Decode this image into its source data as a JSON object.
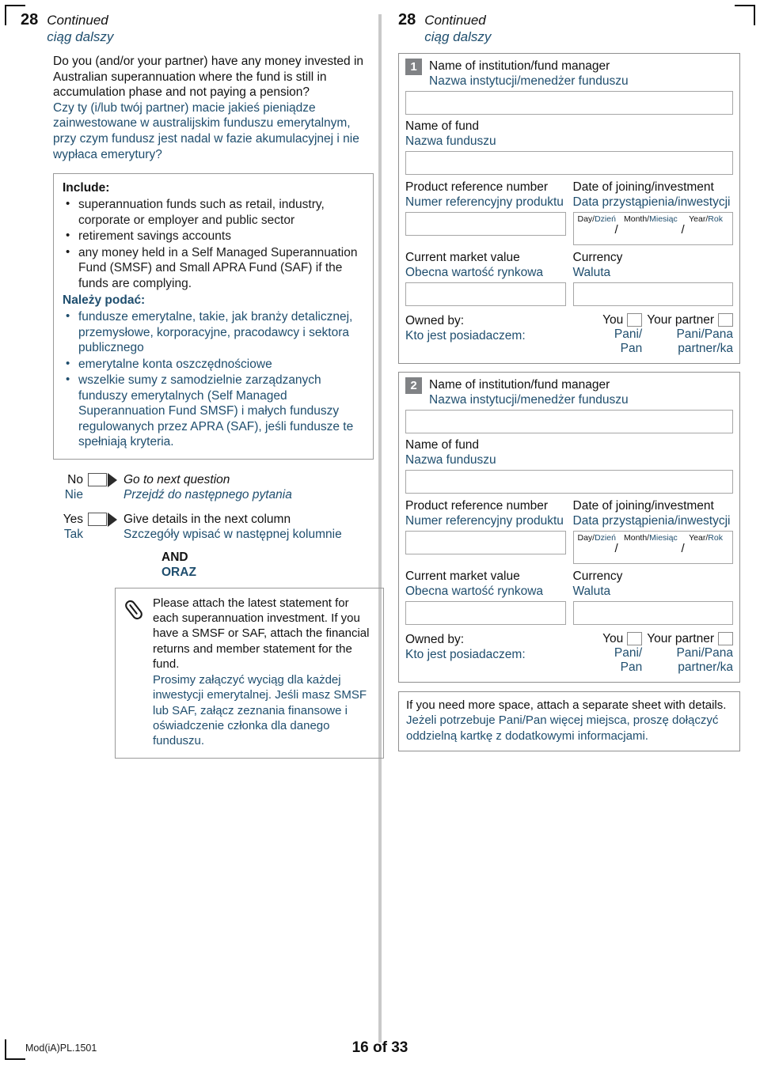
{
  "page": {
    "question_number": "28",
    "continued_en": "Continued",
    "continued_pl": "ciąg dalszy",
    "footer_code": "Mod(iA)PL.1501",
    "footer_page": "16 of 33",
    "accent_blue": "#1f4e6e",
    "badge_gray": "#808285",
    "rule_gray": "#c9c9c9"
  },
  "left": {
    "question_en": "Do you (and/or your partner) have any money invested in Australian superannuation where the fund is still in accumulation phase and not paying a pension?",
    "question_pl": "Czy ty (i/lub twój partner) macie jakieś pieniądze zainwestowane w australijskim funduszu emerytalnym, przy czym fundusz jest nadal w fazie akumulacyjnej i nie wypłaca emerytury?",
    "include": {
      "title_en": "Include:",
      "items_en": [
        "superannuation funds such as retail, industry, corporate or employer and public sector",
        "retirement savings accounts",
        "any money held in a Self Managed Superannuation Fund (SMSF) and Small APRA Fund (SAF) if the funds are complying."
      ],
      "title_pl": "Należy podać:",
      "items_pl": [
        "fundusze emerytalne, takie, jak branży detalicznej, przemysłowe, korporacyjne, pracodawcy i sektora publicznego",
        "emerytalne konta oszczędnościowe",
        "wszelkie sumy z samodzielnie zarządzanych funduszy emerytalnych (Self Managed Superannuation Fund SMSF) i małych funduszy regulowanych przez APRA (SAF), jeśli fundusze te spełniają kryteria."
      ]
    },
    "answers": [
      {
        "label_en": "No",
        "label_pl": "Nie",
        "action_en": "Go to next question",
        "action_pl": "Przejdź do następnego pytania"
      },
      {
        "label_en": "Yes",
        "label_pl": "Tak",
        "action_en": "Give details in the next column",
        "action_pl": "Szczegóły wpisać w następnej kolumnie"
      }
    ],
    "and_en": "AND",
    "and_pl": "ORAZ",
    "attach_note": {
      "icon": "paperclip-icon",
      "text_en": "Please attach the latest statement for each superannuation investment. If you have a SMSF or SAF, attach the financial returns and member statement for the fund.",
      "text_pl": "Prosimy załączyć wyciąg dla każdej inwestycji emerytalnej. Jeśli masz SMSF lub SAF, załącz zeznania finansowe i oświadczenie członka dla danego funduszu."
    }
  },
  "right": {
    "labels": {
      "institution_en": "Name of institution/fund manager",
      "institution_pl": "Nazwa instytucji/menedżer funduszu",
      "fund_en": "Name of fund",
      "fund_pl": "Nazwa funduszu",
      "product_en": "Product reference number",
      "product_pl": "Numer referencyjny produktu",
      "date_en": "Date of joining/investment",
      "date_pl": "Data przystąpienia/inwestycji",
      "day_en": "Day/",
      "day_pl": "Dzień",
      "month_en": "Month/",
      "month_pl": "Miesiąc",
      "year_en": "Year/",
      "year_pl": "Rok",
      "slash1": "/",
      "slash2": "/",
      "market_en": "Current market value",
      "market_pl": "Obecna wartość rynkowa",
      "currency_en": "Currency",
      "currency_pl": "Waluta",
      "owned_en": "Owned by:",
      "owned_pl": "Kto jest posiadaczem:",
      "you_en": "You",
      "you_pl1": "Pani/",
      "you_pl2": "Pan",
      "partner_en": "Your partner",
      "partner_pl1": "Pani/Pana",
      "partner_pl2": "partner/ka"
    },
    "entries": [
      {
        "number": "1"
      },
      {
        "number": "2"
      }
    ],
    "more_space": {
      "text_en": "If you need more space, attach a separate sheet with details.",
      "text_pl": "Jeżeli potrzebuje Pani/Pan więcej miejsca, proszę dołączyć oddzielną kartkę z dodatkowymi informacjami."
    }
  }
}
